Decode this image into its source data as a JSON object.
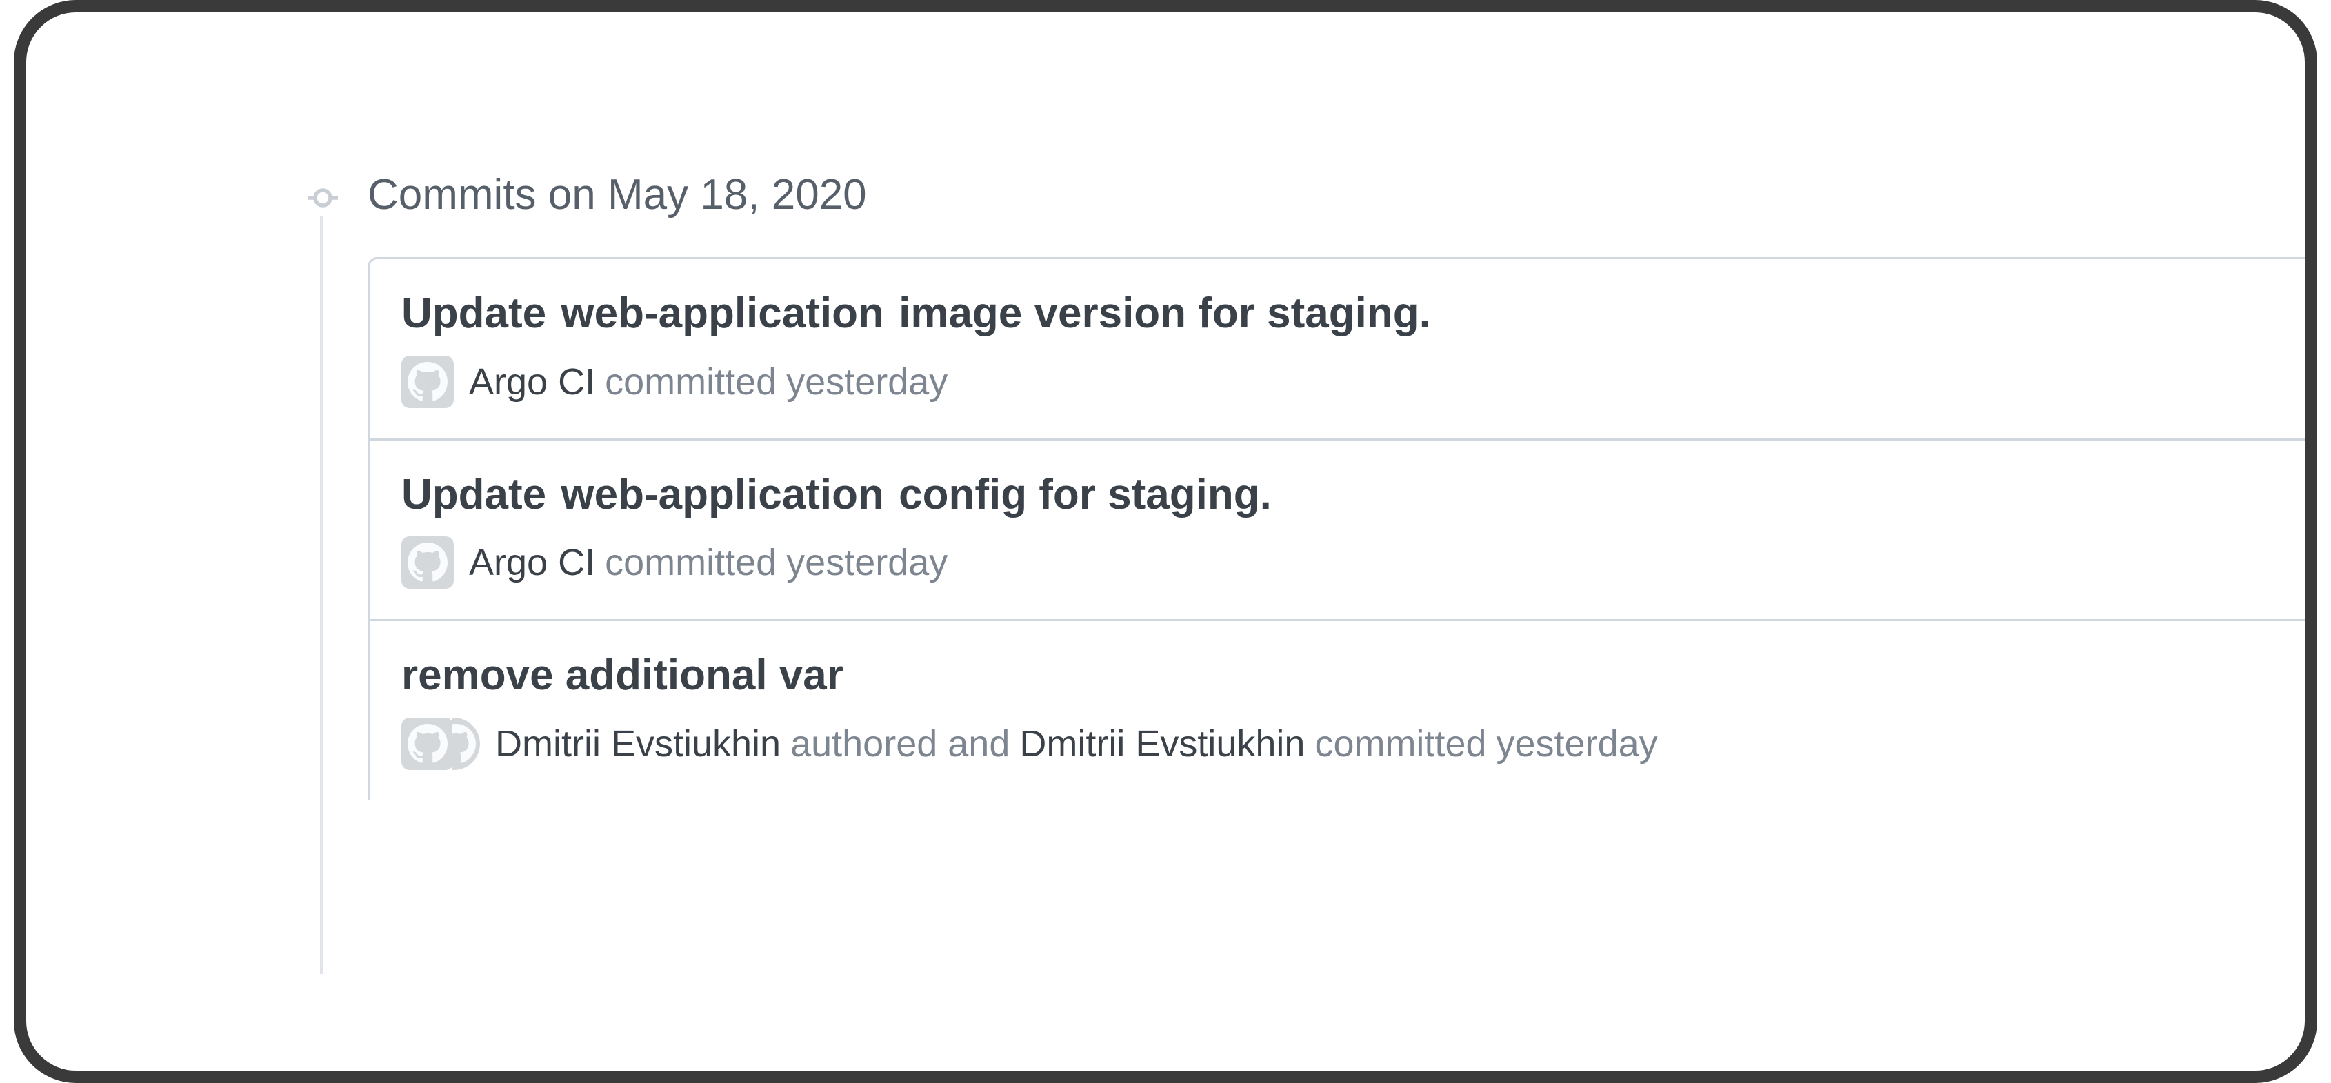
{
  "group_title": "Commits on May 18, 2020",
  "commits": [
    {
      "title_prefix": "Update",
      "title_code": "web-application",
      "title_suffix": "image version for staging.",
      "avatars": [
        "github"
      ],
      "meta": [
        {
          "text": "Argo CI",
          "muted": false
        },
        {
          "text": "committed",
          "muted": true
        },
        {
          "text": "yesterday",
          "muted": true
        }
      ]
    },
    {
      "title_prefix": "Update",
      "title_code": "web-application",
      "title_suffix": "config for staging.",
      "avatars": [
        "github"
      ],
      "meta": [
        {
          "text": "Argo CI",
          "muted": false
        },
        {
          "text": "committed",
          "muted": true
        },
        {
          "text": "yesterday",
          "muted": true
        }
      ]
    },
    {
      "title_prefix": "remove additional var",
      "title_code": "",
      "title_suffix": "",
      "avatars": [
        "github",
        "github"
      ],
      "meta": [
        {
          "text": "Dmitrii Evstiukhin",
          "muted": false
        },
        {
          "text": "authored and",
          "muted": true
        },
        {
          "text": "Dmitrii Evstiukhin",
          "muted": false
        },
        {
          "text": "committed",
          "muted": true
        },
        {
          "text": "yesterday",
          "muted": true
        }
      ]
    }
  ]
}
